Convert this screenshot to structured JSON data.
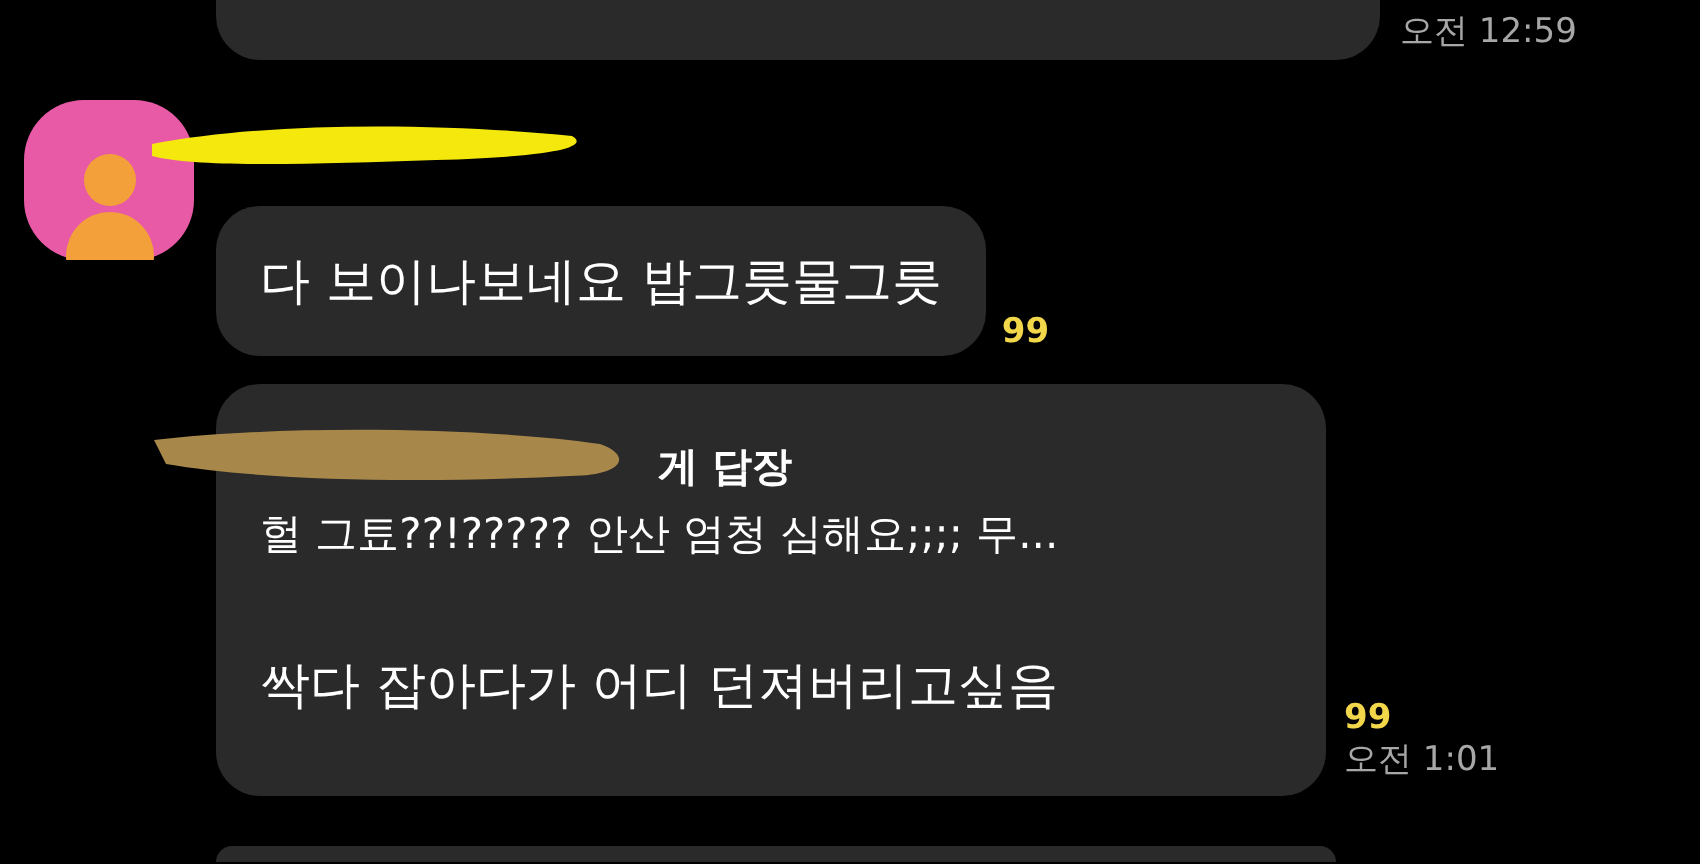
{
  "messages": [
    {
      "kind": "cut",
      "time": "오전 12:59"
    },
    {
      "kind": "text",
      "text": "다 보이나보네요 밥그릇물그릇",
      "unread": "99"
    },
    {
      "kind": "reply",
      "reply_header": "게 답장",
      "quote": "헐 그툐??!????? 안산 엄청 심해요;;;; 무...",
      "text": "싹다 잡아다가 어디 던져버리고싶음",
      "unread": "99",
      "time": "오전 1:01"
    },
    {
      "kind": "cut"
    }
  ]
}
